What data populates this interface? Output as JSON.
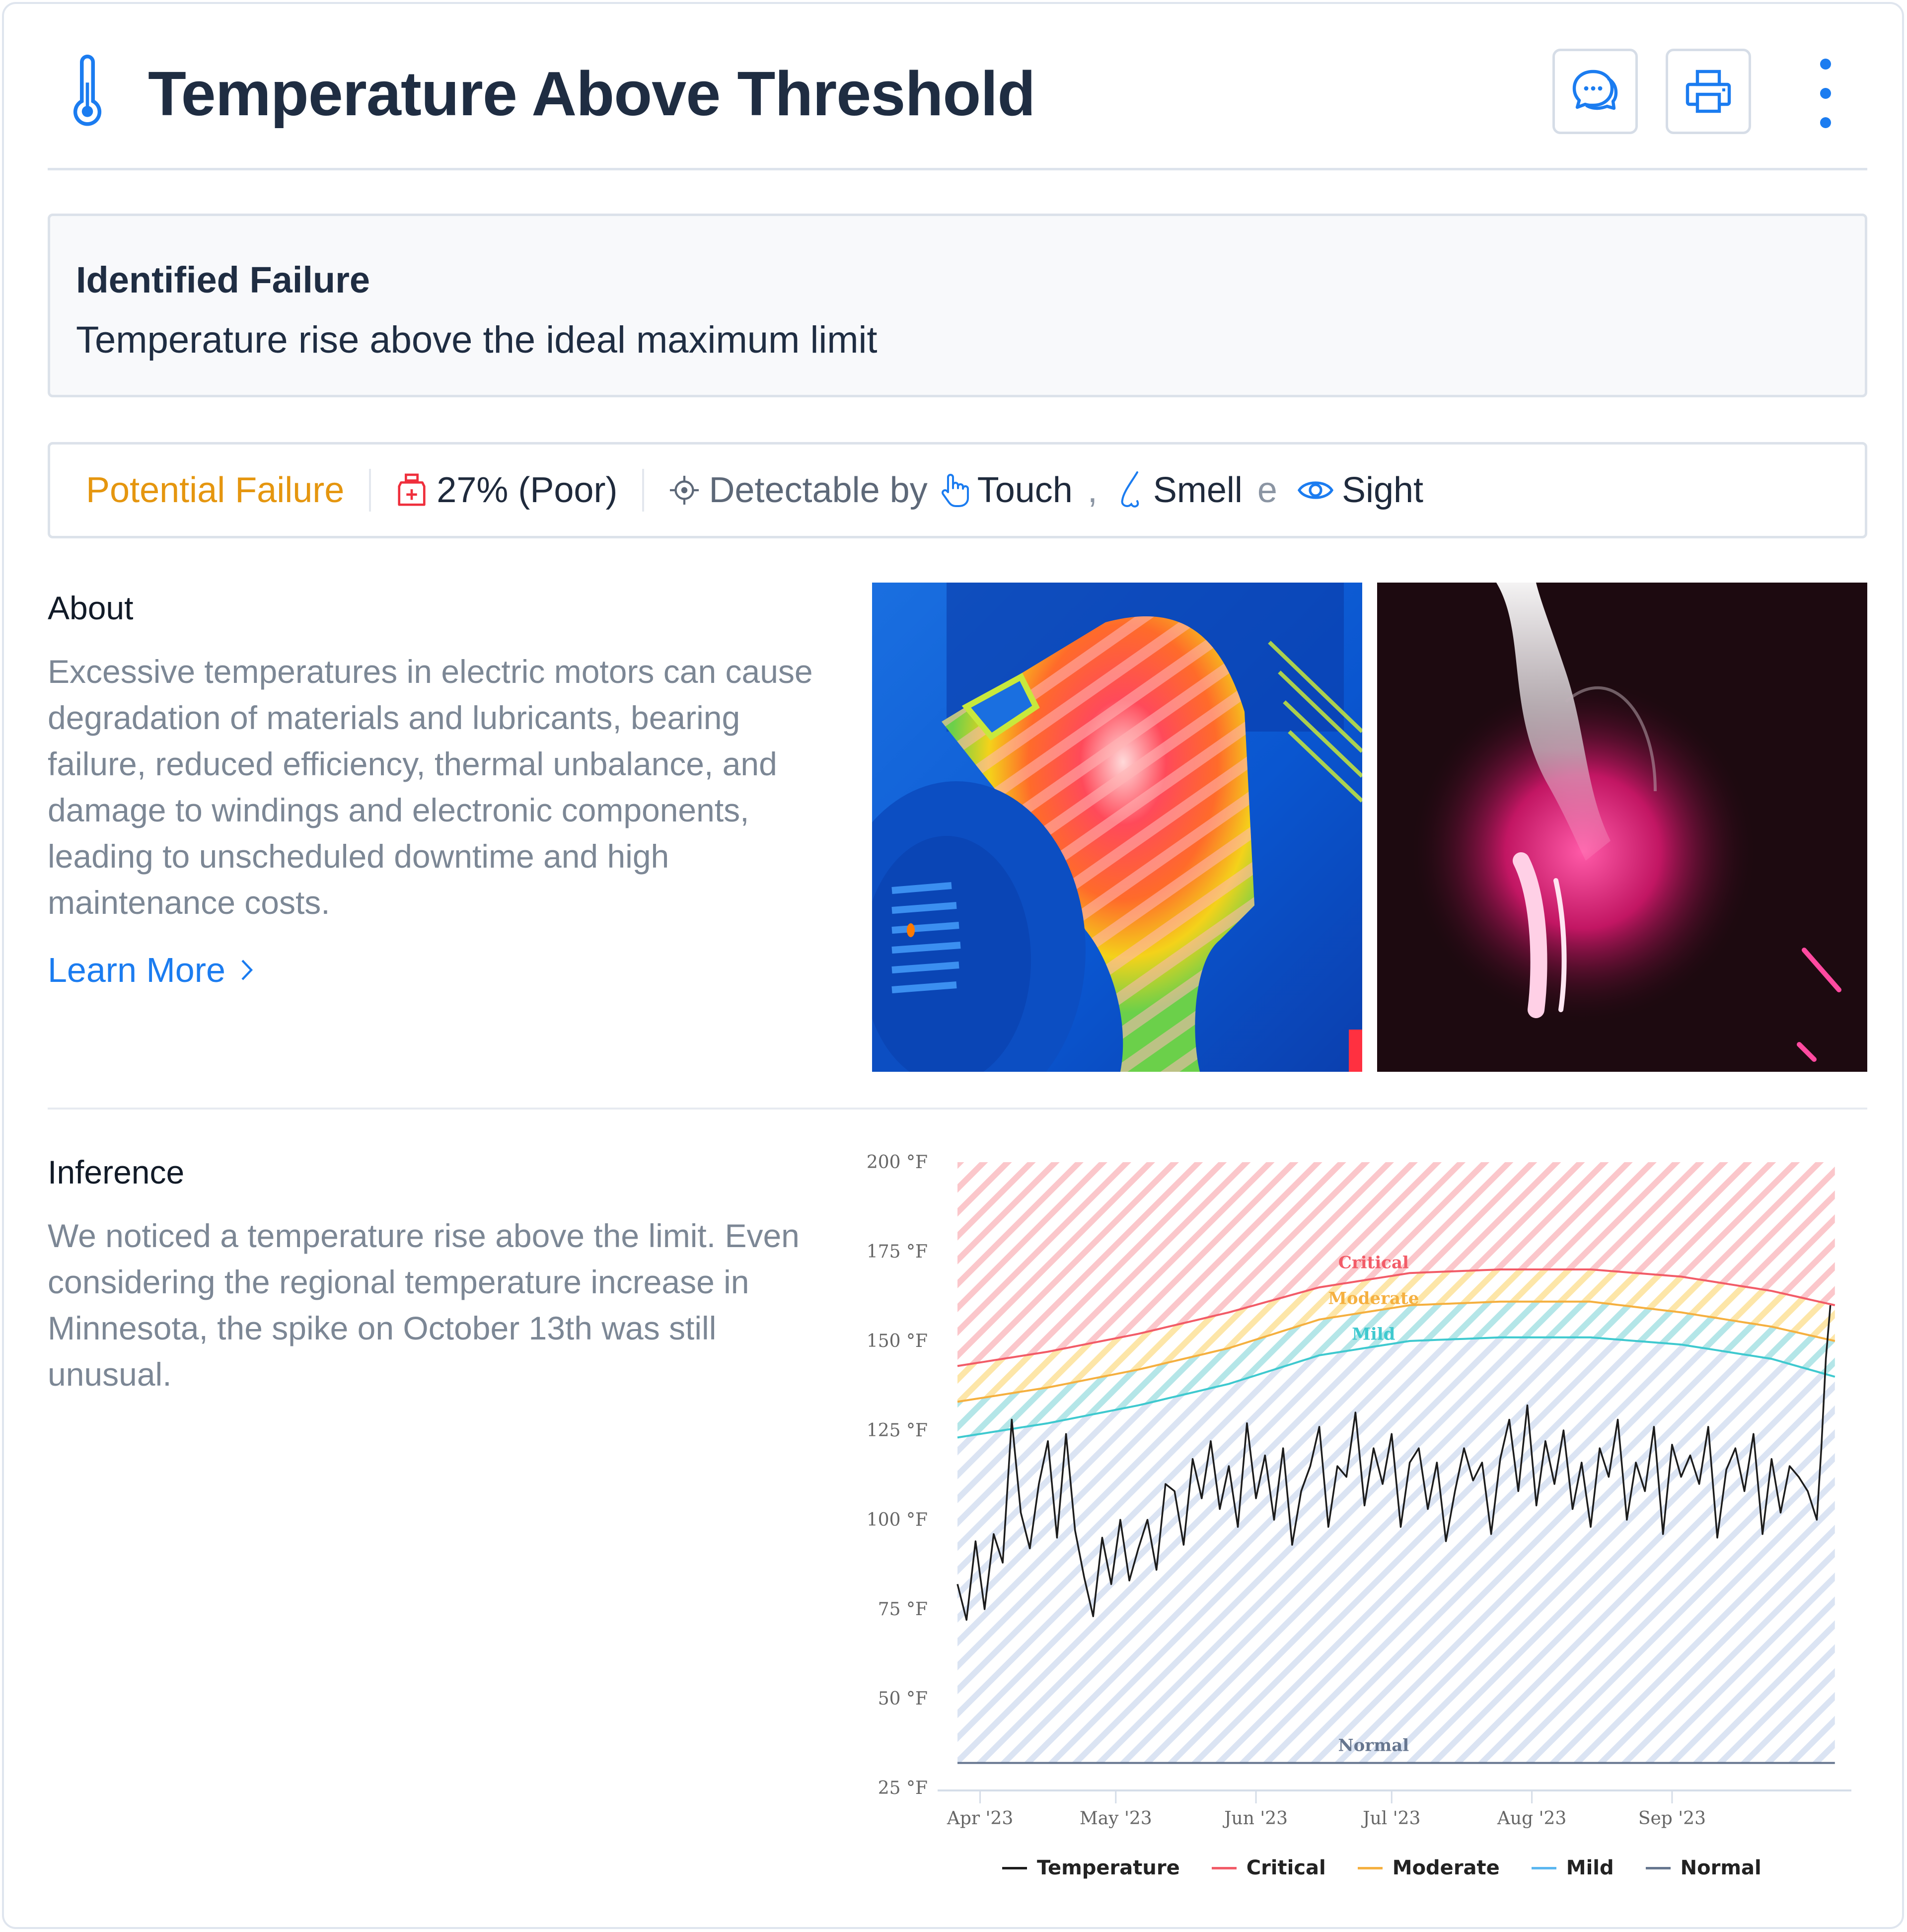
{
  "header": {
    "title": "Temperature Above Threshold",
    "icon": "thermometer-icon",
    "actions": [
      {
        "name": "comments",
        "icon": "chat-bubbles-icon"
      },
      {
        "name": "print",
        "icon": "printer-icon"
      },
      {
        "name": "more",
        "icon": "kebab-menu-icon"
      }
    ]
  },
  "identified_failure": {
    "heading": "Identified Failure",
    "text": "Temperature rise above the ideal maximum limit"
  },
  "status": {
    "category": "Potential Failure",
    "category_color": "#e5960f",
    "health_icon": "medical-kit-icon",
    "health": "27% (Poor)",
    "detect_icon": "crosshair-icon",
    "detect_label": "Detectable by",
    "senses": [
      {
        "label": "Touch",
        "icon": "hand-pointer-icon"
      },
      {
        "label": "Smell",
        "icon": "nose-icon"
      },
      {
        "label": "Sight",
        "icon": "eye-icon"
      }
    ],
    "separator_comma": ",",
    "conjunction": "e"
  },
  "about": {
    "heading": "About",
    "text": "Excessive temperatures in electric motors can cause degradation of materials and lubricants, bearing failure, reduced efficiency, thermal unbalance, and damage to windings and electronic components, leading to unscheduled downtime and high maintenance costs.",
    "link": "Learn More",
    "images": [
      {
        "name": "thermal-image-motor",
        "desc": "Thermal camera image of electric motor"
      },
      {
        "name": "smoking-bearing-image",
        "desc": "Overheated glowing component with smoke"
      }
    ]
  },
  "inference": {
    "heading": "Inference",
    "text": "We noticed a temperature rise above the limit. Even considering the regional temperature increase in Minnesota, the spike on October 13th was still unusual."
  },
  "colors": {
    "accent": "#1b7cf0",
    "critical": "#f25c68",
    "moderate": "#f5b040",
    "mild": "#3fc9cf",
    "normal": "#66768f",
    "temperature": "#1c1c1c"
  },
  "chart_data": {
    "type": "line",
    "title": "",
    "xlabel": "",
    "ylabel": "",
    "ylim": [
      25,
      200
    ],
    "y_ticks": [
      25,
      50,
      75,
      100,
      125,
      150,
      175,
      200
    ],
    "y_tick_labels": [
      "25 °F",
      "50 °F",
      "75 °F",
      "100 °F",
      "125 °F",
      "150 °F",
      "175 °F",
      "200 °F"
    ],
    "x_range_days": [
      0,
      196
    ],
    "x_ticks": [
      {
        "label": "Apr '23",
        "day": 5
      },
      {
        "label": "May '23",
        "day": 35
      },
      {
        "label": "Jun '23",
        "day": 66
      },
      {
        "label": "Jul '23",
        "day": 96
      },
      {
        "label": "Aug '23",
        "day": 127
      },
      {
        "label": "Sep '23",
        "day": 158
      }
    ],
    "bands": [
      {
        "name": "Critical",
        "label_day": 92,
        "label_value": 172
      },
      {
        "name": "Moderate",
        "label_day": 92,
        "label_value": 162
      },
      {
        "name": "Mild",
        "label_day": 92,
        "label_value": 152
      },
      {
        "name": "Normal",
        "label_day": 92,
        "label_value": 37
      }
    ],
    "legend": [
      "Temperature",
      "Critical",
      "Moderate",
      "Mild",
      "Normal"
    ],
    "legend_position": "bottom",
    "grid": false,
    "series": [
      {
        "name": "Critical",
        "x": [
          0,
          20,
          40,
          60,
          80,
          100,
          120,
          140,
          160,
          180,
          194
        ],
        "values": [
          143,
          147,
          152,
          158,
          165,
          169,
          170,
          170,
          168,
          164,
          160
        ]
      },
      {
        "name": "Moderate",
        "x": [
          0,
          20,
          40,
          60,
          80,
          100,
          120,
          140,
          160,
          180,
          194
        ],
        "values": [
          133,
          137,
          142,
          148,
          156,
          160,
          161,
          161,
          158,
          154,
          150
        ]
      },
      {
        "name": "Mild",
        "x": [
          0,
          20,
          40,
          60,
          80,
          100,
          120,
          140,
          160,
          180,
          194
        ],
        "values": [
          123,
          127,
          132,
          138,
          146,
          150,
          151,
          151,
          149,
          145,
          140
        ]
      },
      {
        "name": "Normal",
        "x": [
          0,
          194
        ],
        "values": [
          32,
          32
        ]
      },
      {
        "name": "Temperature",
        "x": [
          0,
          2,
          4,
          6,
          8,
          10,
          12,
          14,
          16,
          18,
          20,
          22,
          24,
          26,
          28,
          30,
          32,
          34,
          36,
          38,
          40,
          42,
          44,
          46,
          48,
          50,
          52,
          54,
          56,
          58,
          60,
          62,
          64,
          66,
          68,
          70,
          72,
          74,
          76,
          78,
          80,
          82,
          84,
          86,
          88,
          90,
          92,
          94,
          96,
          98,
          100,
          102,
          104,
          106,
          108,
          110,
          112,
          114,
          116,
          118,
          120,
          122,
          124,
          126,
          128,
          130,
          132,
          134,
          136,
          138,
          140,
          142,
          144,
          146,
          148,
          150,
          152,
          154,
          156,
          158,
          160,
          162,
          164,
          166,
          168,
          170,
          172,
          174,
          176,
          178,
          180,
          182,
          184,
          186,
          188,
          190,
          191,
          192,
          193
        ],
        "values": [
          82,
          72,
          94,
          75,
          96,
          88,
          128,
          102,
          92,
          110,
          122,
          95,
          124,
          97,
          84,
          73,
          95,
          82,
          100,
          83,
          92,
          100,
          86,
          110,
          108,
          93,
          117,
          106,
          122,
          103,
          115,
          98,
          127,
          106,
          118,
          100,
          120,
          93,
          108,
          115,
          126,
          98,
          115,
          112,
          130,
          104,
          120,
          110,
          124,
          98,
          116,
          120,
          103,
          116,
          94,
          108,
          120,
          111,
          116,
          96,
          117,
          128,
          108,
          132,
          104,
          122,
          110,
          125,
          103,
          116,
          98,
          120,
          112,
          128,
          100,
          116,
          108,
          126,
          96,
          121,
          112,
          118,
          110,
          126,
          95,
          114,
          120,
          108,
          124,
          96,
          117,
          102,
          115,
          112,
          108,
          100,
          120,
          145,
          160
        ]
      }
    ]
  }
}
